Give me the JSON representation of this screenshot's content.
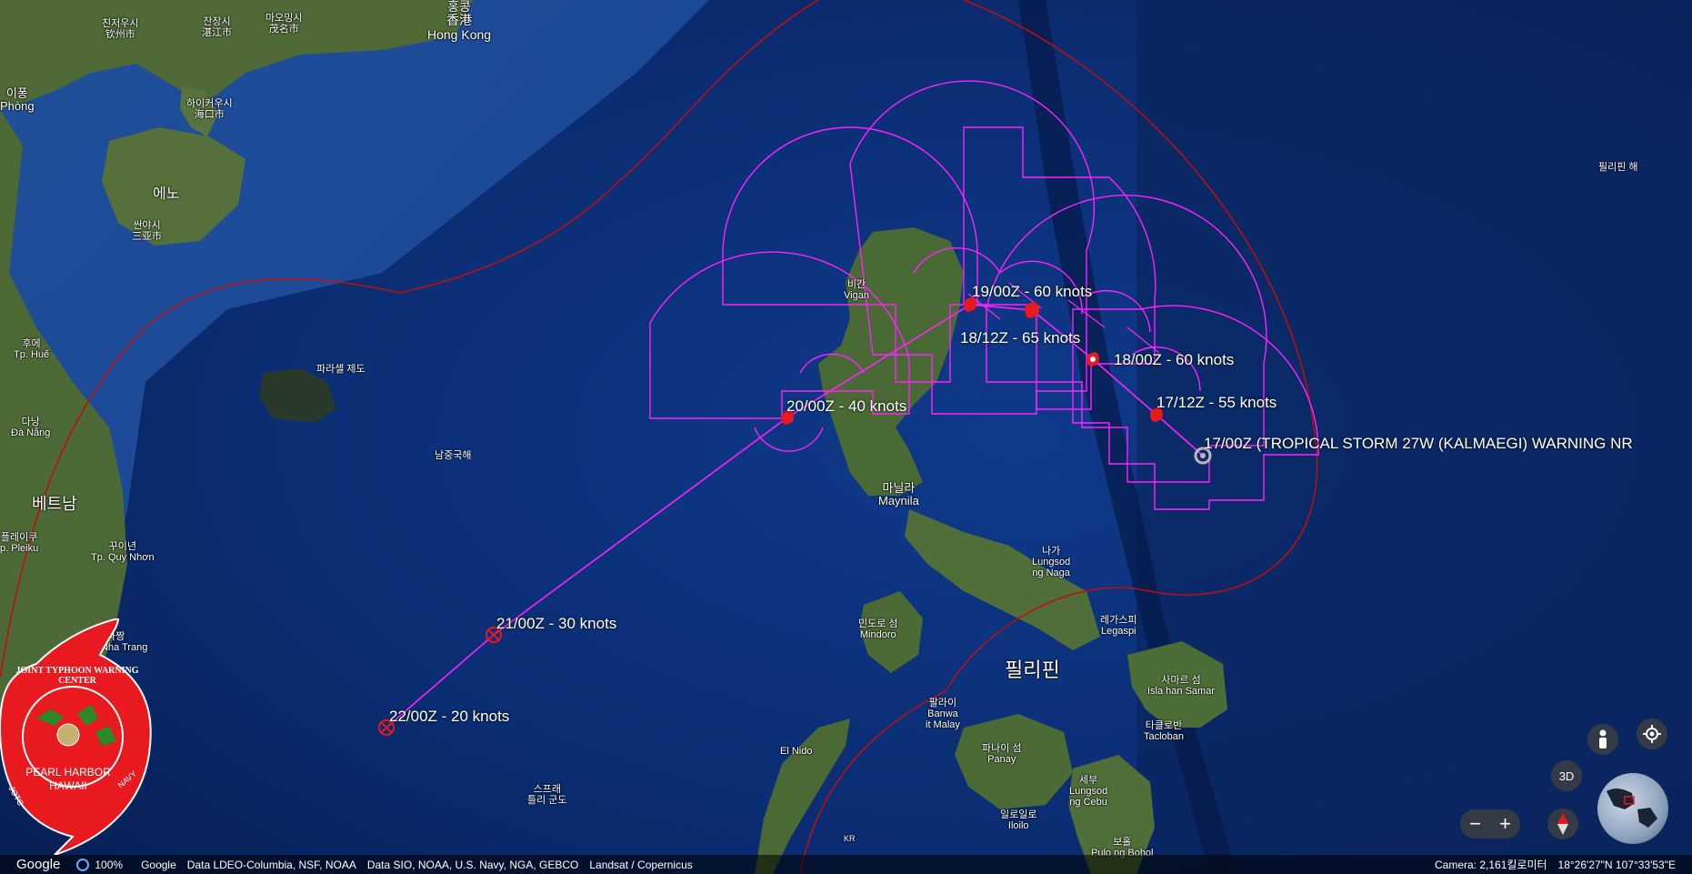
{
  "colors": {
    "track": "#ff00ff",
    "warn_red": "#cc0000",
    "ocean_deep": "#0a2a6b",
    "land": "#4e6b35",
    "label_white": "#ffffff"
  },
  "places": [
    {
      "id": "hongkong",
      "ko": "홍콩\n香港",
      "en": "Hong Kong"
    },
    {
      "id": "haiphong",
      "ko": "이퐁",
      "en": "Phòng"
    },
    {
      "id": "hainan",
      "ko": "에노",
      "en": ""
    },
    {
      "id": "sanya",
      "ko": "싼야시\n三亚市",
      "en": ""
    },
    {
      "id": "haikou",
      "ko": "하이커우시\n海口市",
      "en": ""
    },
    {
      "id": "qinzhou",
      "ko": "친저우시\n钦州市",
      "en": ""
    },
    {
      "id": "zhanjiang",
      "ko": "잔장시\n湛江市",
      "en": ""
    },
    {
      "id": "maoming",
      "ko": "마오밍시\n茂名市",
      "en": ""
    },
    {
      "id": "hue",
      "ko": "후에",
      "en": "Tp. Huế"
    },
    {
      "id": "danang",
      "ko": "다낭",
      "en": "Đà Nẵng"
    },
    {
      "id": "vietnam",
      "ko": "베트남",
      "en": ""
    },
    {
      "id": "pleiku",
      "ko": "플레이쿠",
      "en": "p. Pleiku"
    },
    {
      "id": "quinhon",
      "ko": "꾸이년",
      "en": "Tp. Quy Nhơn"
    },
    {
      "id": "nhatrang",
      "ko": "나짱",
      "en": "Tp. Nha Trang"
    },
    {
      "id": "paracel",
      "ko": "파라셀 제도",
      "en": ""
    },
    {
      "id": "southsea",
      "ko": "남중국해",
      "en": ""
    },
    {
      "id": "vigan",
      "ko": "비간",
      "en": "Vigan"
    },
    {
      "id": "manila",
      "ko": "마닐라",
      "en": "Maynila"
    },
    {
      "id": "naga",
      "ko": "나가",
      "en": "Lungsod\nng Naga"
    },
    {
      "id": "legazpi",
      "ko": "레가스피",
      "en": "Legaspi"
    },
    {
      "id": "mindoro",
      "ko": "민도로 섬",
      "en": "Mindoro"
    },
    {
      "id": "philippines",
      "ko": "필리핀",
      "en": ""
    },
    {
      "id": "samar",
      "ko": "사마르 섬",
      "en": "Isla han Samar"
    },
    {
      "id": "tacloban",
      "ko": "타클로반",
      "en": "Tacloban"
    },
    {
      "id": "banwa",
      "ko": "팔라이",
      "en": "Banwa\nit Malay"
    },
    {
      "id": "panay",
      "ko": "파나이 섬",
      "en": "Panay"
    },
    {
      "id": "elnido",
      "ko": "",
      "en": "El Nido"
    },
    {
      "id": "cebu",
      "ko": "세부",
      "en": "Lungsod\nng Cebu"
    },
    {
      "id": "iloilo",
      "ko": "일로일로",
      "en": "Iloilo"
    },
    {
      "id": "spratly",
      "ko": "스프래\n틀리 군도",
      "en": ""
    },
    {
      "id": "philsea",
      "ko": "필리핀 해",
      "en": ""
    },
    {
      "id": "bohol",
      "ko": "보홀",
      "en": "Pulo ng Bohol"
    },
    {
      "id": "kr",
      "ko": "",
      "en": "KR"
    }
  ],
  "track_points": [
    {
      "time": "17/00Z",
      "label": "17/00Z (TROPICAL STORM 27W (KALMAEGI) WARNING NR",
      "type": "current"
    },
    {
      "time": "17/12Z",
      "label": "17/12Z - 55 knots",
      "type": "storm"
    },
    {
      "time": "18/00Z",
      "label": "18/00Z - 60 knots",
      "type": "storm"
    },
    {
      "time": "18/12Z",
      "label": "18/12Z - 65 knots",
      "type": "typhoon"
    },
    {
      "time": "19/00Z",
      "label": "19/00Z - 60 knots",
      "type": "storm"
    },
    {
      "time": "20/00Z",
      "label": "20/00Z - 40 knots",
      "type": "storm"
    },
    {
      "time": "21/00Z",
      "label": "21/00Z - 30 knots",
      "type": "depression"
    },
    {
      "time": "22/00Z",
      "label": "22/00Z - 20 knots",
      "type": "depression"
    }
  ],
  "logo": {
    "ring_text": "JOINT TYPHOON WARNING CENTER",
    "location_line1": "PEARL HARBOR",
    "location_line2": "HAWAII",
    "ring_left": "JOTC",
    "ring_right": "NAVY"
  },
  "controls": {
    "view_3d": "3D",
    "zoom_out": "−",
    "zoom_in": "+",
    "pegman_icon": "person-icon",
    "location_icon": "my-location-icon",
    "compass_icon": "compass-icon",
    "globe_icon": "globe-icon"
  },
  "bottom_bar": {
    "google": "Google",
    "zoom_level": "100%",
    "credit_google": "Google",
    "credit_data1": "Data LDEO-Columbia, NSF, NOAA",
    "credit_data2": "Data SIO, NOAA, U.S. Navy, NGA, GEBCO",
    "credit_landsat": "Landsat / Copernicus",
    "camera": "Camera: 2,161킬로미터",
    "coords": "18°26'27\"N 107°33'53\"E"
  }
}
